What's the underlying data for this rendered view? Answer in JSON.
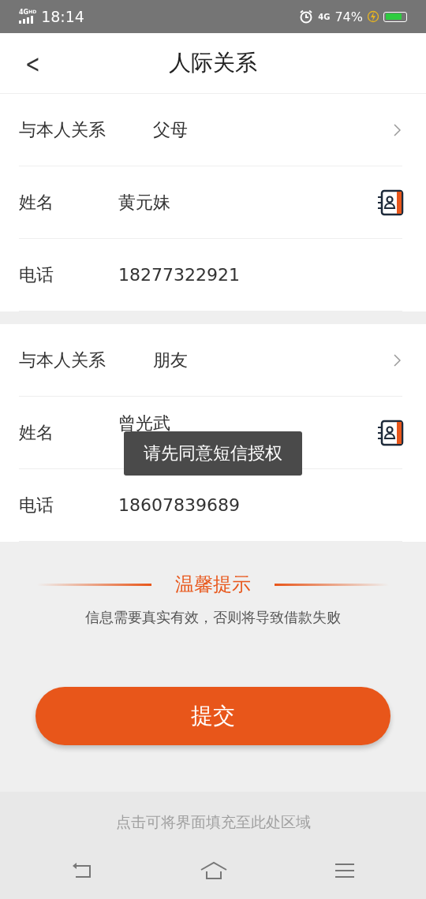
{
  "status_bar": {
    "network": "4G",
    "network_hd": "HD",
    "time": "18:14",
    "data_type": "4G",
    "battery": "74%",
    "charging": true,
    "level": 0.8
  },
  "header": {
    "back": "<",
    "title": "人际关系"
  },
  "contacts": [
    {
      "rows": [
        {
          "kind": "select",
          "label": "与本人关系",
          "value": "父母"
        },
        {
          "kind": "contact",
          "label": "姓名",
          "value": "黄元妹"
        },
        {
          "kind": "text",
          "label": "电话",
          "value": "18277322921"
        }
      ]
    },
    {
      "rows": [
        {
          "kind": "select",
          "label": "与本人关系",
          "value": "朋友"
        },
        {
          "kind": "contact",
          "label": "姓名",
          "value": "曾光武"
        },
        {
          "kind": "text",
          "label": "电话",
          "value": "18607839689"
        }
      ]
    }
  ],
  "toast": "请先同意短信授权",
  "tip": {
    "title": "温馨提示",
    "text": "信息需要真实有效，否则将导致借款失败"
  },
  "submit": "提交",
  "fill_hint": "点击可将界面填充至此处区域"
}
